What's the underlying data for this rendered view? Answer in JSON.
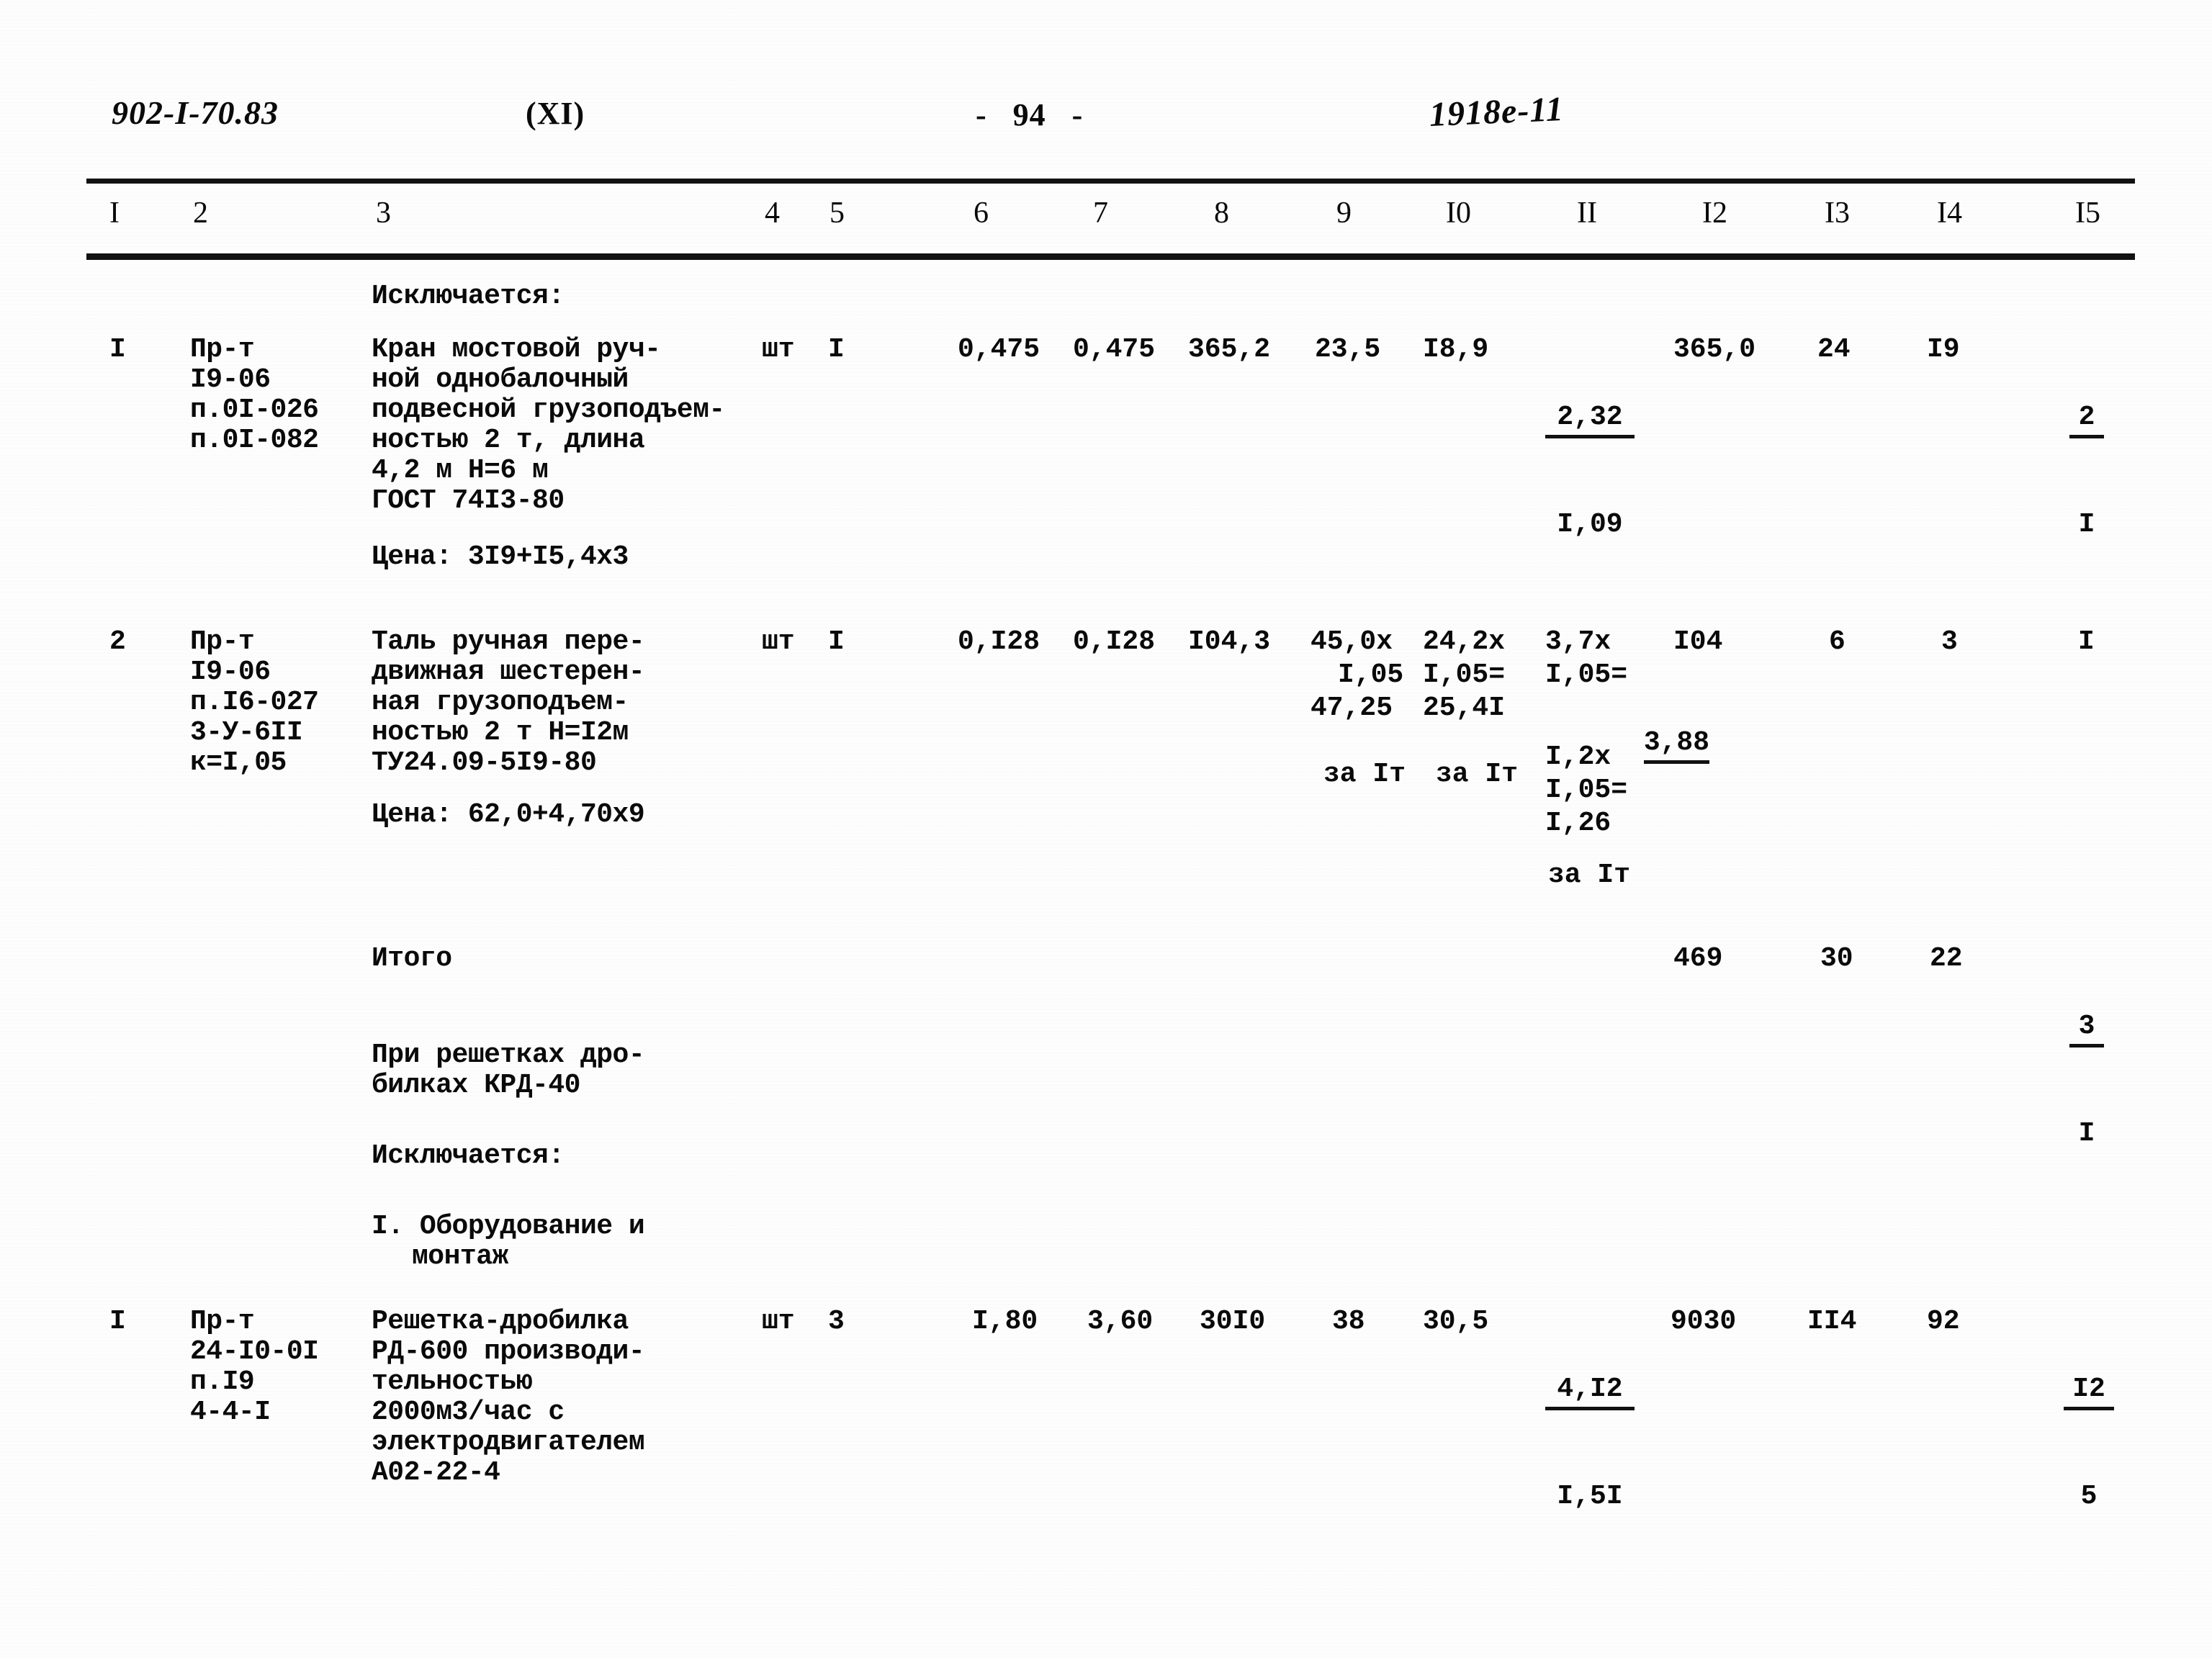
{
  "header": {
    "doc_code": "902-I-70.83",
    "part": "(XI)",
    "page_marker": "-   94   -",
    "stamp": "1918е-11"
  },
  "table": {
    "column_headers": [
      "I",
      "2",
      "3",
      "4",
      "5",
      "6",
      "7",
      "8",
      "9",
      "I0",
      "II",
      "I2",
      "I3",
      "I4",
      "I5"
    ],
    "section_label_excluded_1": "Исключается:",
    "rows": [
      {
        "no": "I",
        "code_lines": [
          "Пр-т",
          "I9-06",
          "п.0I-026",
          "п.0I-082"
        ],
        "desc_lines": [
          "Кран мостовой руч-",
          "ной однобалочный",
          "подвесной грузоподъем-",
          "ностью 2 т, длина",
          "4,2 м H=6 м",
          "ГОСТ 74I3-80"
        ],
        "price_line": "Цена: 3I9+I5,4x3",
        "unit": "шт",
        "qty": "I",
        "c6": "0,475",
        "c7": "0,475",
        "c8": "365,2",
        "c9": "23,5",
        "c10": "I8,9",
        "c11_numer": "2,32",
        "c11_denom": "I,09",
        "c12": "365,0",
        "c13": "24",
        "c14": "I9",
        "c15_numer": "2",
        "c15_denom": "I"
      },
      {
        "no": "2",
        "code_lines": [
          "Пр-т",
          "I9-06",
          "п.I6-027",
          "3-У-6II",
          "к=I,05"
        ],
        "desc_lines": [
          "Таль ручная пере-",
          "движная шестерен-",
          "ная грузоподъем-",
          "ностью 2 т H=I2м",
          "ТУ24.09-5I9-80"
        ],
        "price_line": "Цена: 62,0+4,70x9",
        "unit": "шт",
        "qty": "I",
        "c6": "0,I28",
        "c7": "0,I28",
        "c8": "I04,3",
        "c9_lines": [
          "45,0x",
          "I,05",
          "47,25",
          "",
          "за Iт"
        ],
        "c10_lines": [
          "24,2x",
          "I,05=",
          "25,4I",
          "",
          "за Iт"
        ],
        "c11_lines": [
          "3,7x",
          "I,05=",
          "3,88",
          "I,2x",
          "I,05=",
          "I,26",
          "за Iт"
        ],
        "c12": "I04",
        "c13": "6",
        "c14": "3",
        "c15": "I"
      }
    ],
    "total": {
      "label": "Итого",
      "c12": "469",
      "c13": "30",
      "c14": "22",
      "c15_numer": "3",
      "c15_denom": "I"
    },
    "note_block": {
      "line1": "При решетках дро-",
      "line2": "билках КРД-40",
      "excluded": "Исключается:",
      "subsection_line1": "I. Оборудование и",
      "subsection_line2": "монтаж"
    },
    "row3": {
      "no": "I",
      "code_lines": [
        "Пр-т",
        "24-I0-0I",
        "п.I9",
        "4-4-I"
      ],
      "desc_lines": [
        "Решетка-дробилка",
        "РД-600 производи-",
        "тельностью",
        "2000м3/час с",
        "электродвигателем",
        "А02-22-4"
      ],
      "unit": "шт",
      "qty": "3",
      "c6": "I,80",
      "c7": "3,60",
      "c8": "30I0",
      "c9": "38",
      "c10": "30,5",
      "c11_numer": "4,I2",
      "c11_denom": "I,5I",
      "c12": "9030",
      "c13": "II4",
      "c14": "92",
      "c15_numer": "I2",
      "c15_denom": "5"
    }
  }
}
